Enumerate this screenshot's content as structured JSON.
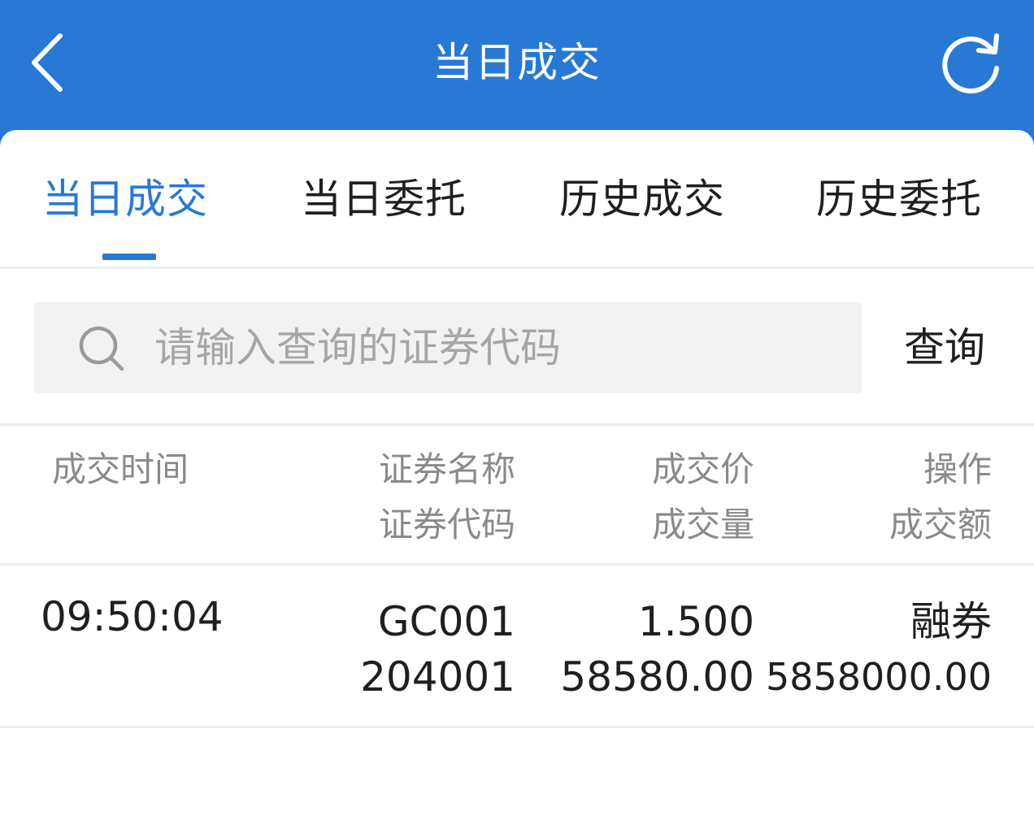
{
  "header": {
    "title": "当日成交",
    "back_icon": "chevron-left-icon",
    "refresh_icon": "refresh-icon"
  },
  "tabs": [
    {
      "label": "当日成交",
      "active": true
    },
    {
      "label": "当日委托",
      "active": false
    },
    {
      "label": "历史成交",
      "active": false
    },
    {
      "label": "历史委托",
      "active": false
    }
  ],
  "search": {
    "placeholder": "请输入查询的证券代码",
    "value": "",
    "button_label": "查询",
    "icon": "search-icon"
  },
  "table": {
    "headers": {
      "time": "成交时间",
      "name": "证券名称",
      "code": "证券代码",
      "price": "成交价",
      "qty": "成交量",
      "op": "操作",
      "amount": "成交额"
    },
    "rows": [
      {
        "time": "09:50:04",
        "name": "GC001",
        "code": "204001",
        "price": "1.500",
        "qty": "58580.00",
        "op": "融券",
        "amount": "5858000.00"
      }
    ]
  },
  "colors": {
    "accent": "#2878d6",
    "text": "#1f1f1f",
    "muted": "#8a8a8a",
    "placeholder": "#a6a6a6",
    "divider": "#ececec",
    "search_bg": "#f2f2f2"
  }
}
